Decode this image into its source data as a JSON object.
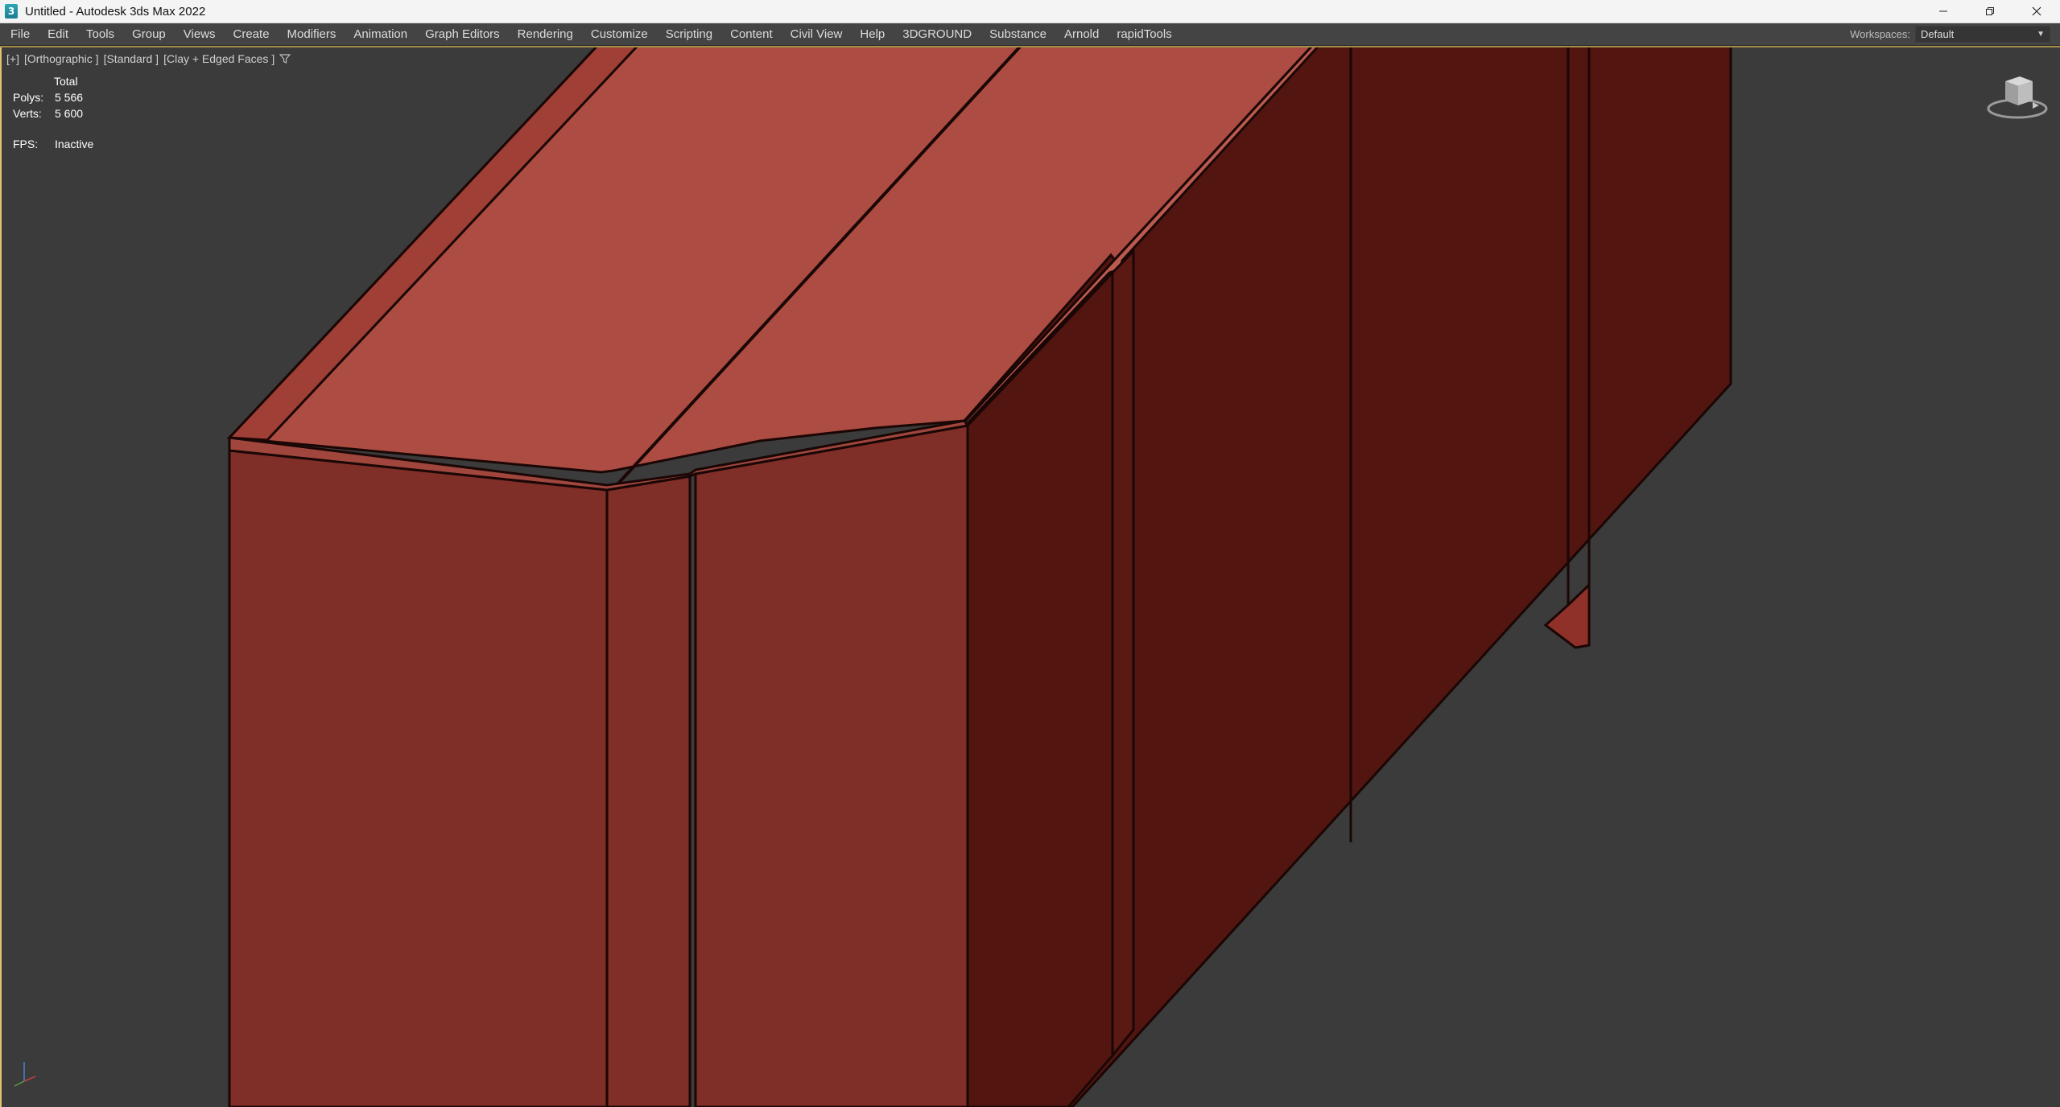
{
  "window": {
    "app_icon_glyph": "3",
    "title": "Untitled - Autodesk 3ds Max 2022",
    "controls": [
      "minimize-icon",
      "restore-icon",
      "close-icon"
    ]
  },
  "menubar": {
    "items": [
      "File",
      "Edit",
      "Tools",
      "Group",
      "Views",
      "Create",
      "Modifiers",
      "Animation",
      "Graph Editors",
      "Rendering",
      "Customize",
      "Scripting",
      "Content",
      "Civil View",
      "Help",
      "3DGROUND",
      "Substance",
      "Arnold",
      "rapidTools"
    ],
    "workspaces_label": "Workspaces:",
    "workspace_value": "Default"
  },
  "viewport": {
    "label_plus": "[+]",
    "label_view": "[Orthographic ]",
    "label_shading_standard": "[Standard ]",
    "label_shading_mode": "[Clay + Edged Faces ]",
    "filter_icon": "filter-icon",
    "stats": {
      "header": "Total",
      "polys_label": "Polys:",
      "polys_value": "5 566",
      "verts_label": "Verts:",
      "verts_value": "5 600",
      "fps_label": "FPS:",
      "fps_value": "Inactive"
    },
    "viewcube_icon": "viewcube-icon",
    "axis_icon": "axis-tripod-icon"
  },
  "colors": {
    "viewport_bg": "#3b3b3b",
    "menubar_bg": "#444444",
    "titlebar_bg": "#f4f4f4",
    "model_top": "#ad4c42",
    "model_front": "#7f2e28",
    "model_side": "#521510",
    "edge": "#1a0705"
  }
}
